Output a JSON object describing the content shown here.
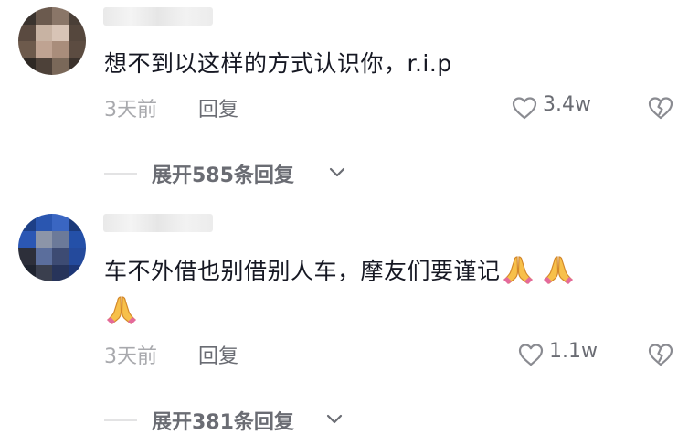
{
  "comments": [
    {
      "username": "",
      "text": "想不到以这样的方式认识你，r.i.p",
      "time": "3天前",
      "reply_label": "回复",
      "like_count": "3.4w",
      "expand_label": "展开585条回复"
    },
    {
      "username": "",
      "text_line1": "车不外借也别借别人车，摩友们要谨记",
      "time": "3天前",
      "reply_label": "回复",
      "like_count": "1.1w",
      "expand_label": "展开381条回复"
    }
  ],
  "icons": {
    "like": "heart-outline-icon",
    "dislike": "broken-heart-icon",
    "expand": "chevron-down-icon",
    "emoji": "folded-hands-emoji"
  },
  "colors": {
    "text_primary": "#161823",
    "text_secondary": "#6a6c73",
    "text_muted": "#a8a9ad"
  }
}
